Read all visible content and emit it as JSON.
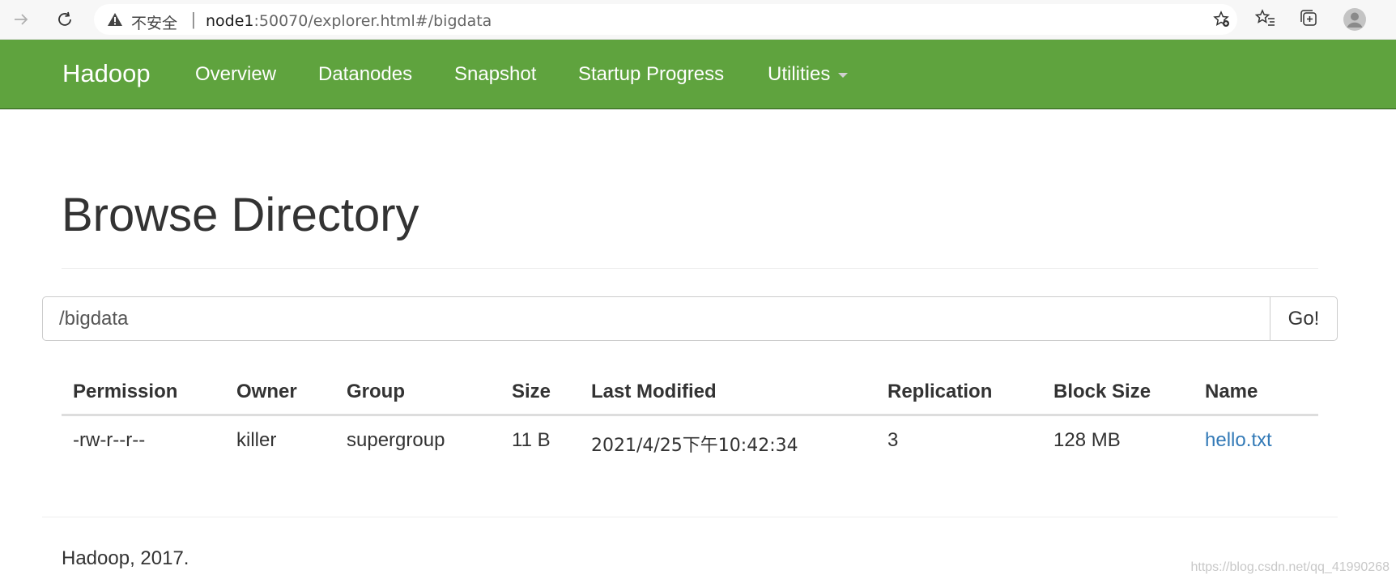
{
  "browser": {
    "security_label": "不安全",
    "separator": "|",
    "url_host": "node1",
    "url_rest": ":50070/explorer.html#/bigdata"
  },
  "navbar": {
    "brand": "Hadoop",
    "items": [
      "Overview",
      "Datanodes",
      "Snapshot",
      "Startup Progress",
      "Utilities"
    ]
  },
  "page": {
    "title": "Browse Directory",
    "path_value": "/bigdata",
    "go_label": "Go!"
  },
  "table": {
    "headers": [
      "Permission",
      "Owner",
      "Group",
      "Size",
      "Last Modified",
      "Replication",
      "Block Size",
      "Name"
    ],
    "rows": [
      [
        "-rw-r--r--",
        "killer",
        "supergroup",
        "11 B",
        "2021/4/25下午10:42:34",
        "3",
        "128 MB",
        "hello.txt"
      ]
    ]
  },
  "footer": {
    "text": "Hadoop, 2017."
  },
  "watermark": "https://blog.csdn.net/qq_41990268",
  "colors": {
    "navbar": "#5fa33e",
    "link": "#337ab7"
  }
}
